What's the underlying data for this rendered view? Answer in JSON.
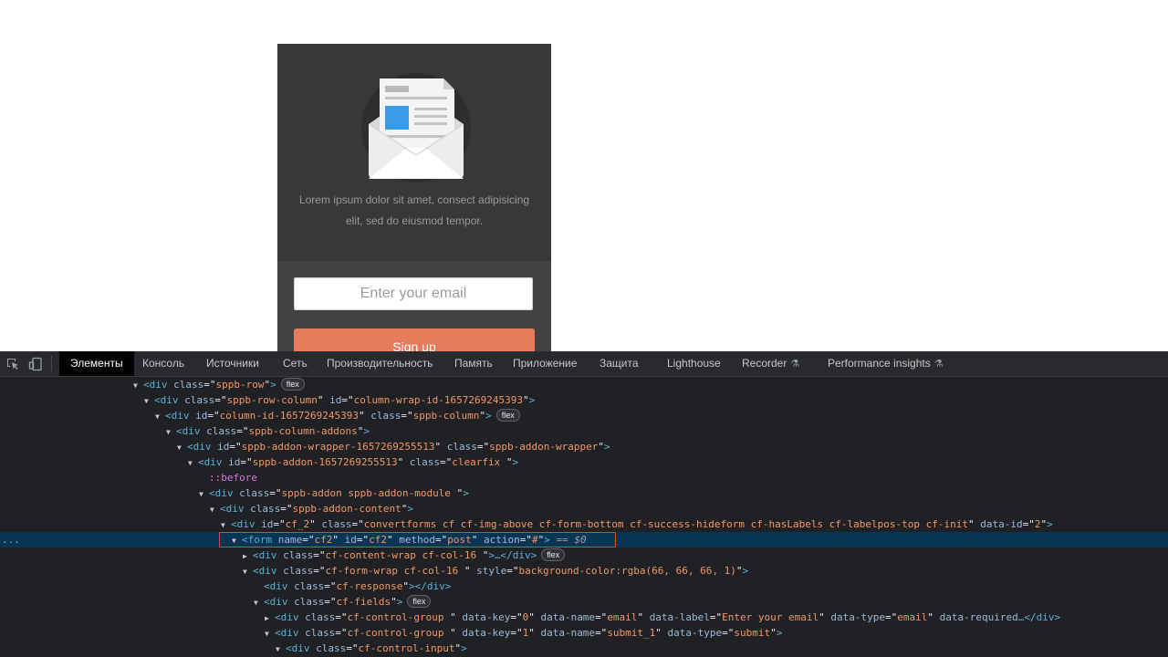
{
  "page": {
    "optin": {
      "description": "Lorem ipsum dolor sit amet, consect adipisicing elit, sed do eiusmod tempor.",
      "email_placeholder": "Enter your email",
      "signup_label": "Sign up",
      "colors": {
        "top_bg": "#383838",
        "form_bg": "#424242",
        "button_bg": "#e67c5b"
      }
    }
  },
  "devtools": {
    "tool_icons": [
      "inspect-element-icon",
      "device-toolbar-icon"
    ],
    "tabs": [
      {
        "label": "Элементы",
        "active": true
      },
      {
        "label": "Консоль"
      },
      {
        "label": "Источники"
      },
      {
        "label": "Сеть"
      },
      {
        "label": "Производительность"
      },
      {
        "label": "Память"
      },
      {
        "label": "Приложение"
      },
      {
        "label": "Защита"
      },
      {
        "label": "Lighthouse"
      },
      {
        "label": "Recorder"
      },
      {
        "label": "Performance insights"
      }
    ],
    "tree": [
      {
        "indent": 146,
        "tri": "open",
        "tag": "div",
        "attrs": [
          [
            "class",
            "sppb-row"
          ]
        ],
        "tail": ">",
        "badge": "flex"
      },
      {
        "indent": 158,
        "tri": "open",
        "tag": "div",
        "attrs": [
          [
            "class",
            "sppb-row-column"
          ],
          [
            "id",
            "column-wrap-id-1657269245393"
          ]
        ],
        "tail": ">"
      },
      {
        "indent": 170,
        "tri": "open",
        "tag": "div",
        "attrs": [
          [
            "id",
            "column-id-1657269245393"
          ],
          [
            "class",
            "sppb-column"
          ]
        ],
        "tail": ">",
        "badge": "flex"
      },
      {
        "indent": 182,
        "tri": "open",
        "tag": "div",
        "attrs": [
          [
            "class",
            "sppb-column-addons"
          ]
        ],
        "tail": ">"
      },
      {
        "indent": 194,
        "tri": "open",
        "tag": "div",
        "attrs": [
          [
            "id",
            "sppb-addon-wrapper-1657269255513"
          ],
          [
            "class",
            "sppb-addon-wrapper"
          ]
        ],
        "tail": ">"
      },
      {
        "indent": 206,
        "tri": "open",
        "tag": "div",
        "attrs": [
          [
            "id",
            "sppb-addon-1657269255513"
          ],
          [
            "class",
            "clearfix "
          ]
        ],
        "tail": ">"
      },
      {
        "indent": 218,
        "tri": "none",
        "pseudo": "::before"
      },
      {
        "indent": 218,
        "tri": "open",
        "tag": "div",
        "attrs": [
          [
            "class",
            "sppb-addon sppb-addon-module "
          ]
        ],
        "tail": ">"
      },
      {
        "indent": 230,
        "tri": "open",
        "tag": "div",
        "attrs": [
          [
            "class",
            "sppb-addon-content"
          ]
        ],
        "tail": ">"
      },
      {
        "indent": 242,
        "tri": "open",
        "tag": "div",
        "attrs": [
          [
            "id",
            "cf_2"
          ],
          [
            "class",
            "convertforms cf cf-img-above cf-form-bottom cf-success-hideform cf-hasLabels cf-labelpos-top cf-init"
          ],
          [
            "data-id",
            "2"
          ]
        ],
        "tail": ">"
      },
      {
        "indent": 254,
        "tri": "open",
        "tag": "form",
        "attrs": [
          [
            "name",
            "cf2"
          ],
          [
            "id",
            "cf2"
          ],
          [
            "method",
            "post"
          ],
          [
            "action",
            "#"
          ]
        ],
        "tail": ">",
        "selected": true,
        "dollar": "== $0"
      },
      {
        "indent": 266,
        "tri": "closed",
        "tag": "div",
        "attrs": [
          [
            "class",
            "cf-content-wrap cf-col-16 "
          ]
        ],
        "tail": ">…</div>",
        "badge": "flex"
      },
      {
        "indent": 266,
        "tri": "open",
        "tag": "div",
        "attrs": [
          [
            "class",
            "cf-form-wrap cf-col-16 "
          ],
          [
            "style",
            "background-color:rgba(66, 66, 66, 1)"
          ]
        ],
        "tail": ">"
      },
      {
        "indent": 278,
        "tri": "none",
        "tag": "div",
        "attrs": [
          [
            "class",
            "cf-response"
          ]
        ],
        "tail": "></div>"
      },
      {
        "indent": 278,
        "tri": "open",
        "tag": "div",
        "attrs": [
          [
            "class",
            "cf-fields"
          ]
        ],
        "tail": ">",
        "badge": "flex"
      },
      {
        "indent": 290,
        "tri": "closed",
        "tag": "div",
        "attrs": [
          [
            "class",
            "cf-control-group "
          ],
          [
            "data-key",
            "0"
          ],
          [
            "data-name",
            "email"
          ],
          [
            "data-label",
            "Enter your email"
          ],
          [
            "data-type",
            "email"
          ],
          [
            "data-required",
            null
          ]
        ],
        "tail": "…</div>"
      },
      {
        "indent": 290,
        "tri": "open",
        "tag": "div",
        "attrs": [
          [
            "class",
            "cf-control-group "
          ],
          [
            "data-key",
            "1"
          ],
          [
            "data-name",
            "submit_1"
          ],
          [
            "data-type",
            "submit"
          ]
        ],
        "tail": ">"
      },
      {
        "indent": 302,
        "tri": "open",
        "tag": "div",
        "attrs": [
          [
            "class",
            "cf-control-input"
          ]
        ],
        "tail": ">"
      }
    ],
    "selected_row_gutter": "..."
  }
}
